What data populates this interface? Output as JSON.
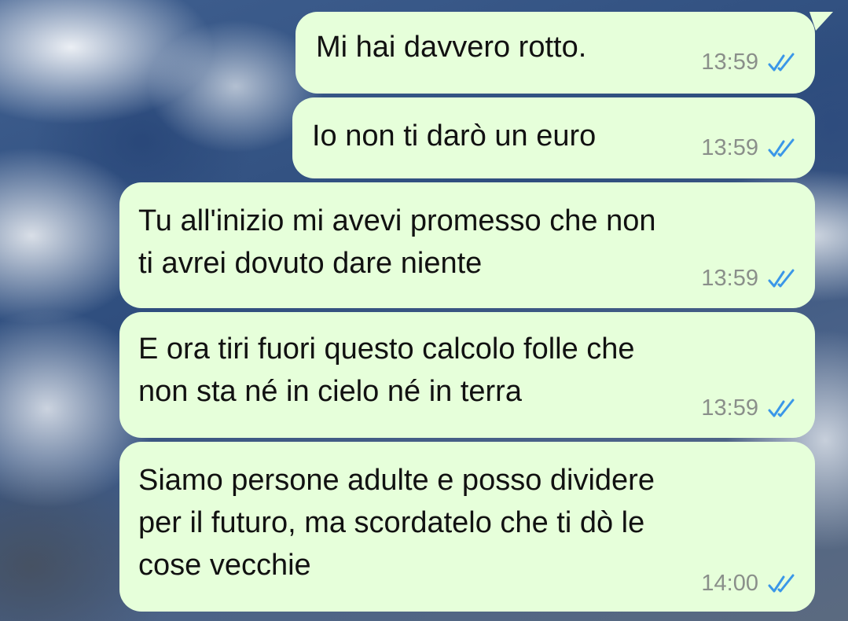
{
  "chat": {
    "messages": [
      {
        "text": "Mi hai davvero rotto.",
        "time": "13:59",
        "status_icon": "double-check-read-icon"
      },
      {
        "text": "Io non ti darò un euro",
        "time": "13:59",
        "status_icon": "double-check-read-icon"
      },
      {
        "text": "Tu all'inizio mi avevi promesso che non\nti avrei dovuto dare niente",
        "time": "13:59",
        "status_icon": "double-check-read-icon"
      },
      {
        "text": "E ora tiri fuori questo calcolo folle che\nnon sta né in cielo né in terra",
        "time": "13:59",
        "status_icon": "double-check-read-icon"
      },
      {
        "text": "Siamo persone adulte e posso dividere\nper il futuro, ma scordatelo che ti dò le\ncose vecchie",
        "time": "14:00",
        "status_icon": "double-check-read-icon"
      }
    ]
  },
  "colors": {
    "bubble": "#e6ffda",
    "read_ticks": "#3a97e8",
    "time": "#8a8f8a"
  }
}
